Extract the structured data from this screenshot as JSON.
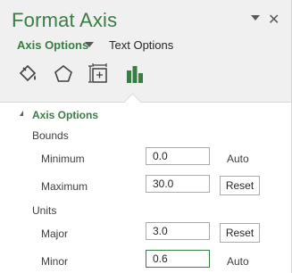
{
  "pane": {
    "title": "Format Axis",
    "close_glyph": "✕",
    "tabs": {
      "axis_options": "Axis Options",
      "text_options": "Text Options"
    },
    "category_icons": [
      "paint-bucket-icon",
      "pentagon-icon",
      "size-properties-icon",
      "bar-chart-icon"
    ],
    "colors": {
      "accent": "#3a7d44",
      "pane_bg": "#f0f0f0"
    }
  },
  "section": {
    "title": "Axis Options",
    "bounds_label": "Bounds",
    "minimum": {
      "label": "Minimum",
      "value": "0.0",
      "state": "Auto"
    },
    "maximum": {
      "label": "Maximum",
      "value": "30.0",
      "button": "Reset"
    },
    "units_label": "Units",
    "major": {
      "label": "Major",
      "value": "3.0",
      "button": "Reset"
    },
    "minor": {
      "label": "Minor",
      "value": "0.6",
      "state": "Auto"
    }
  }
}
